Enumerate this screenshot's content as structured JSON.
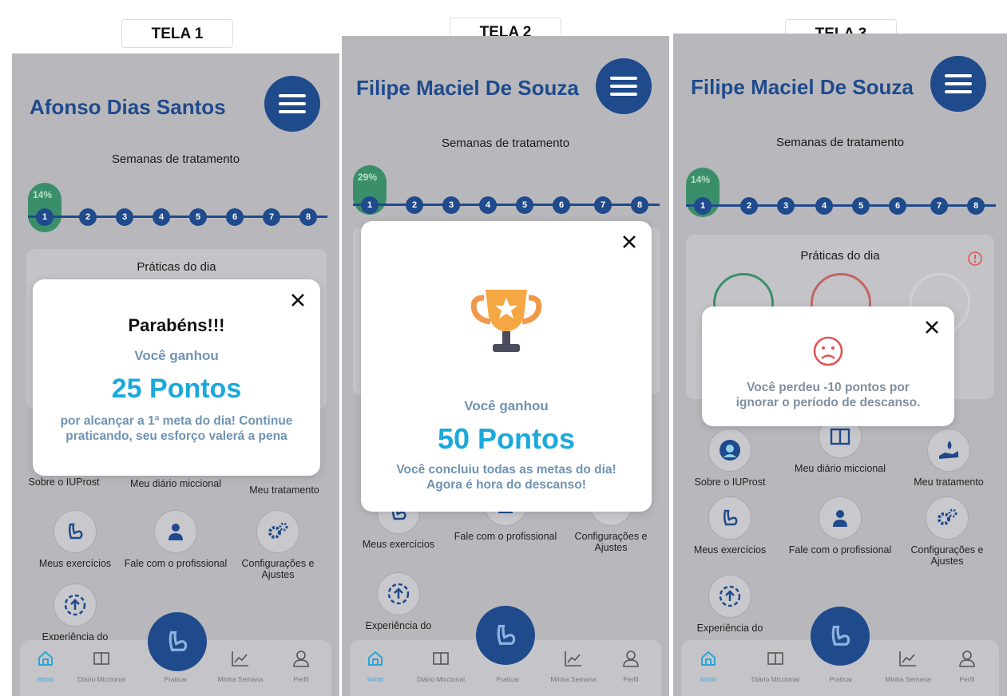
{
  "labels": {
    "s1": "TELA 1",
    "s2": "TELA 2",
    "s3": "TELA 3"
  },
  "screen1": {
    "user_name": "Afonso Dias Santos",
    "weeks_label": "Semanas de tratamento",
    "progress_pct": "14%",
    "weeks": [
      "1",
      "2",
      "3",
      "4",
      "5",
      "6",
      "7",
      "8"
    ],
    "practices_title": "Práticas do dia",
    "modal": {
      "title": "Parabéns!!!",
      "subtitle": "Você ganhou",
      "points": "25 Pontos",
      "message": "por alcançar a 1ª meta do dia! Continue praticando, seu esforço valerá a pena"
    },
    "grid": [
      "Sobre o IUProst",
      "Meu diário miccional",
      "Meu tratamento",
      "Meus exercícios",
      "Fale com o profissional",
      "Configurações e Ajustes",
      "Experiência do"
    ]
  },
  "screen2": {
    "user_name": "Filipe Maciel De Souza",
    "weeks_label": "Semanas de tratamento",
    "progress_pct": "29%",
    "weeks": [
      "1",
      "2",
      "3",
      "4",
      "5",
      "6",
      "7",
      "8"
    ],
    "modal": {
      "subtitle": "Você ganhou",
      "points": "50 Pontos",
      "message": "Você concluiu todas as metas do dia! Agora é hora do descanso!"
    },
    "grid": [
      "Meus exercícios",
      "Fale com o profissional",
      "Configurações e Ajustes",
      "Experiência do"
    ]
  },
  "screen3": {
    "user_name": "Filipe Maciel De Souza",
    "weeks_label": "Semanas de tratamento",
    "progress_pct": "14%",
    "weeks": [
      "1",
      "2",
      "3",
      "4",
      "5",
      "6",
      "7",
      "8"
    ],
    "practices_title": "Práticas do dia",
    "modal": {
      "message": "Você perdeu -10 pontos por ignorar o período de descanso."
    },
    "grid": [
      "Sobre o IUProst",
      "Meu diário miccional",
      "Meu tratamento",
      "Meus exercícios",
      "Fale com o profissional",
      "Configurações e Ajustes",
      "Experiência do"
    ]
  },
  "nav": {
    "items": [
      "Início",
      "Diário Miccional",
      "Praticar",
      "Minha Semana",
      "Perfil"
    ]
  },
  "colors": {
    "primary": "#1f4a8c",
    "accent_cyan": "#1ba9db",
    "progress_green": "#3a8f6a",
    "sad_red": "#e05555"
  },
  "icons": [
    "menu-icon",
    "close-icon",
    "trophy-icon",
    "sad-face-icon",
    "home-icon",
    "diary-icon",
    "arm-icon",
    "chart-icon",
    "user-icon",
    "gears-icon",
    "doctor-icon",
    "upload-circle-icon",
    "droplet-hand-icon",
    "check-icon",
    "lock-icon",
    "alert-icon"
  ]
}
